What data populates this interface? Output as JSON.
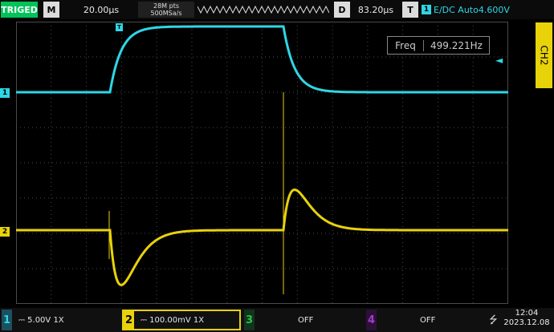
{
  "header": {
    "trigger_status": "TRIGED",
    "mode_button": "M",
    "timebase": "20.00μs",
    "memory_depth": "28M pts",
    "sample_rate": "500MSa/s",
    "delay_button": "D",
    "delay_value": "83.20μs",
    "trigger_button": "T",
    "trigger_source": "1",
    "trigger_settings": "E∕DC Auto4.600V"
  },
  "side_tab": {
    "label": "CH2"
  },
  "measurement": {
    "label": "Freq",
    "value": "499.221Hz"
  },
  "markers": {
    "ch1": "1",
    "ch2": "2",
    "trigger_pos": "T"
  },
  "channels": [
    {
      "number": "1",
      "label": "⎓ 5.00V 1X",
      "color": "#2fd6e6"
    },
    {
      "number": "2",
      "label": "⎓ 100.00mV 1X",
      "color": "#e8d20a"
    },
    {
      "number": "3",
      "label": "OFF",
      "color": "#27c24c"
    },
    {
      "number": "4",
      "label": "OFF",
      "color": "#a03cc8"
    }
  ],
  "status": {
    "time": "12:04",
    "date": "2023.12.08",
    "usb_icon": "usb-icon"
  },
  "colors": {
    "ch1": "#2fd6e6",
    "ch2": "#e8d20a",
    "triged": "#00c35a",
    "grid": "#5a5a5a"
  }
}
